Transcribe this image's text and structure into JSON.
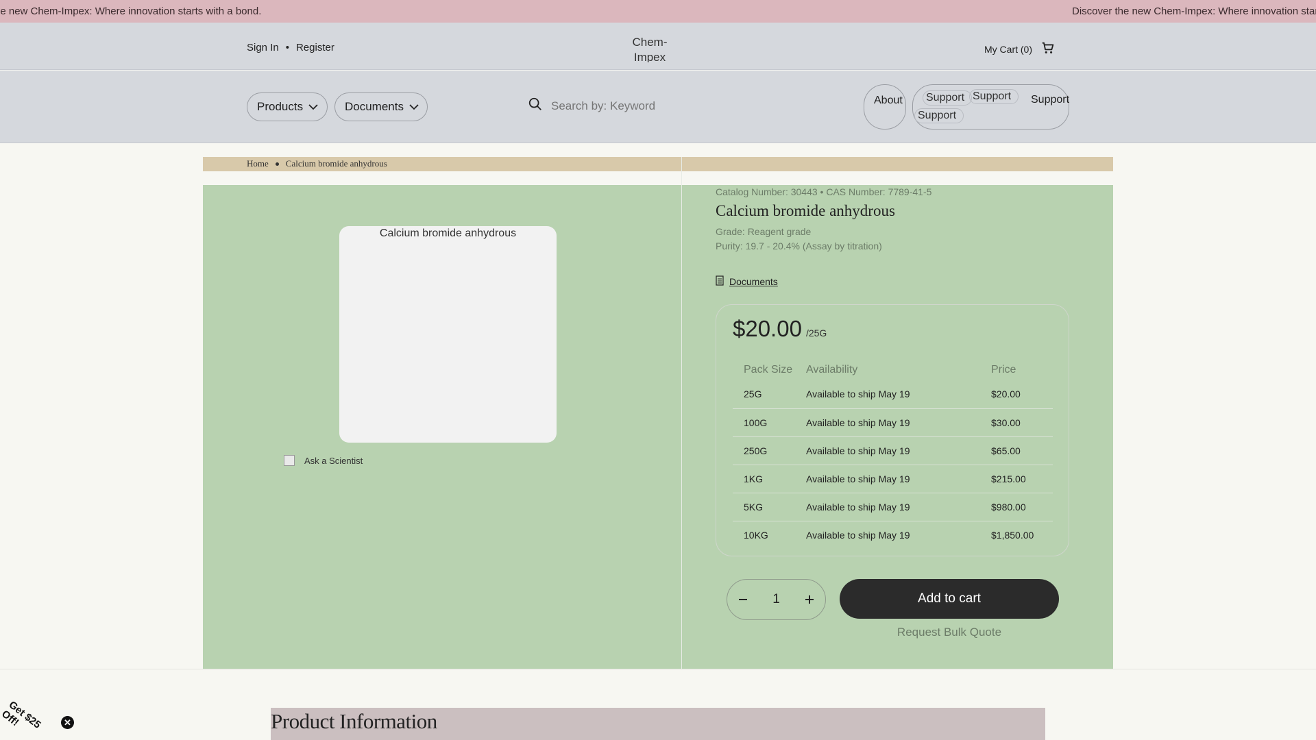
{
  "announcement": {
    "text_left": "he new Chem-Impex: Where innovation starts with a bond.",
    "text_right": "Discover the new Chem-Impex: Where innovation star"
  },
  "header": {
    "sign_in": "Sign In",
    "separator": "•",
    "register": "Register",
    "logo_alt": "Chem-Impex",
    "cart_label": "My Cart (0)",
    "cart_icon": "cart-icon"
  },
  "nav": {
    "products_label": "Products",
    "documents_label": "Documents",
    "search_placeholder": "Search by: Keyword",
    "about_label": "About",
    "support_label": "Support",
    "support_img_alt_1": "Support",
    "support_img_alt_2": "Support",
    "support_img_alt_3": "Support"
  },
  "breadcrumb": {
    "home": "Home",
    "current": "Calcium bromide anhydrous"
  },
  "product": {
    "image_alt": "Calcium bromide anhydrous",
    "ask_scientist": "Ask a Scientist",
    "catalog_line": "Catalog Number: 30443 • CAS Number: 7789-41-5",
    "title": "Calcium bromide anhydrous",
    "grade_line": "Grade: Reagent grade",
    "purity_line": "Purity: 19.7 - 20.4% (Assay by titration)",
    "documents_link": "Documents",
    "price": "$20.00",
    "price_unit": "/25G",
    "table_headers": [
      "Pack Size",
      "Availability",
      "Price"
    ],
    "rows": [
      {
        "size": "25G",
        "availability": "Available to ship May 19",
        "price": "$20.00"
      },
      {
        "size": "100G",
        "availability": "Available to ship May 19",
        "price": "$30.00"
      },
      {
        "size": "250G",
        "availability": "Available to ship May 19",
        "price": "$65.00"
      },
      {
        "size": "1KG",
        "availability": "Available to ship May 19",
        "price": "$215.00"
      },
      {
        "size": "5KG",
        "availability": "Available to ship May 19",
        "price": "$980.00"
      },
      {
        "size": "10KG",
        "availability": "Available to ship May 19",
        "price": "$1,850.00"
      }
    ],
    "quantity": "1",
    "add_to_cart": "Add to cart",
    "bulk_quote": "Request Bulk Quote"
  },
  "section": {
    "product_information": "Product Information"
  },
  "promo": {
    "text": "Get $25 Off!",
    "close": "✕"
  }
}
